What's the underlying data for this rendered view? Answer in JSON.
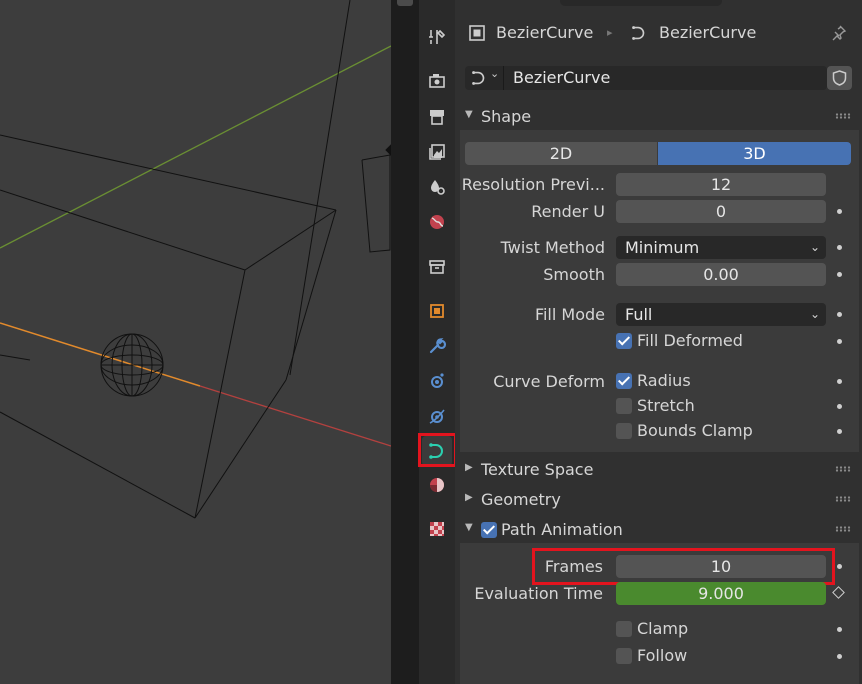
{
  "breadcrumb": {
    "object_name": "BezierCurve",
    "data_name": "BezierCurve"
  },
  "datablock": {
    "name": "BezierCurve"
  },
  "shape": {
    "title": "Shape",
    "dim_2d": "2D",
    "dim_3d": "3D",
    "selected_dimension": "3D",
    "resolution_preview_label": "Resolution Previ...",
    "resolution_preview_value": "12",
    "render_u_label": "Render U",
    "render_u_value": "0",
    "twist_method_label": "Twist Method",
    "twist_method_value": "Minimum",
    "smooth_label": "Smooth",
    "smooth_value": "0.00",
    "fill_mode_label": "Fill Mode",
    "fill_mode_value": "Full",
    "fill_deformed_label": "Fill Deformed",
    "curve_deform_label": "Curve Deform",
    "radius_label": "Radius",
    "stretch_label": "Stretch",
    "bounds_clamp_label": "Bounds Clamp"
  },
  "panels": {
    "texture_space": "Texture Space",
    "geometry": "Geometry",
    "path_animation": "Path Animation"
  },
  "path_animation": {
    "frames_label": "Frames",
    "frames_value": "10",
    "evaluation_time_label": "Evaluation Time",
    "evaluation_time_value": "9.000",
    "clamp_label": "Clamp",
    "follow_label": "Follow"
  },
  "colors": {
    "accent_blue": "#4772b3",
    "keyframed_green": "#4a8a2e",
    "highlight_red": "#e3141e",
    "curve_tab_teal": "#2bd0b0"
  },
  "tabs": [
    "tool-icon",
    "render-icon",
    "output-icon",
    "view-layer-icon",
    "scene-icon",
    "world-icon",
    "collection-icon",
    "object-icon",
    "modifier-icon",
    "particles-icon",
    "physics-icon",
    "curve-data-icon",
    "material-icon",
    "texture-icon"
  ]
}
